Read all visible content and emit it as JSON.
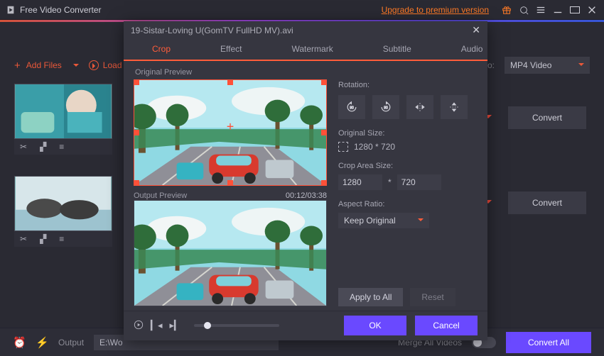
{
  "app": {
    "name": "Free Video Converter",
    "upgrade_label": "Upgrade to premium version"
  },
  "toolbar": {
    "add_files_label": "Add Files",
    "load_dvd_label": "Load",
    "convert_to_label": "s to:",
    "format_selected": "MP4 Video"
  },
  "convert_button_label": "Convert",
  "bottom": {
    "output_label": "Output",
    "output_path": "E:\\Wo",
    "merge_label": "Merge All Videos",
    "convert_all_label": "Convert All"
  },
  "modal": {
    "title": "19-Sistar-Loving U(GomTV FullHD MV).avi",
    "tabs": [
      "Crop",
      "Effect",
      "Watermark",
      "Subtitle",
      "Audio"
    ],
    "active_tab": 0,
    "original_preview_label": "Original Preview",
    "output_preview_label": "Output Preview",
    "timecode": "00:12/03:38",
    "rotation_label": "Rotation:",
    "original_size_label": "Original Size:",
    "original_size_value": "1280 * 720",
    "crop_area_label": "Crop Area Size:",
    "crop_w": "1280",
    "crop_mid": "*",
    "crop_h": "720",
    "aspect_label": "Aspect Ratio:",
    "aspect_value": "Keep Original",
    "apply_all_label": "Apply to All",
    "reset_label": "Reset",
    "ok_label": "OK",
    "cancel_label": "Cancel"
  }
}
